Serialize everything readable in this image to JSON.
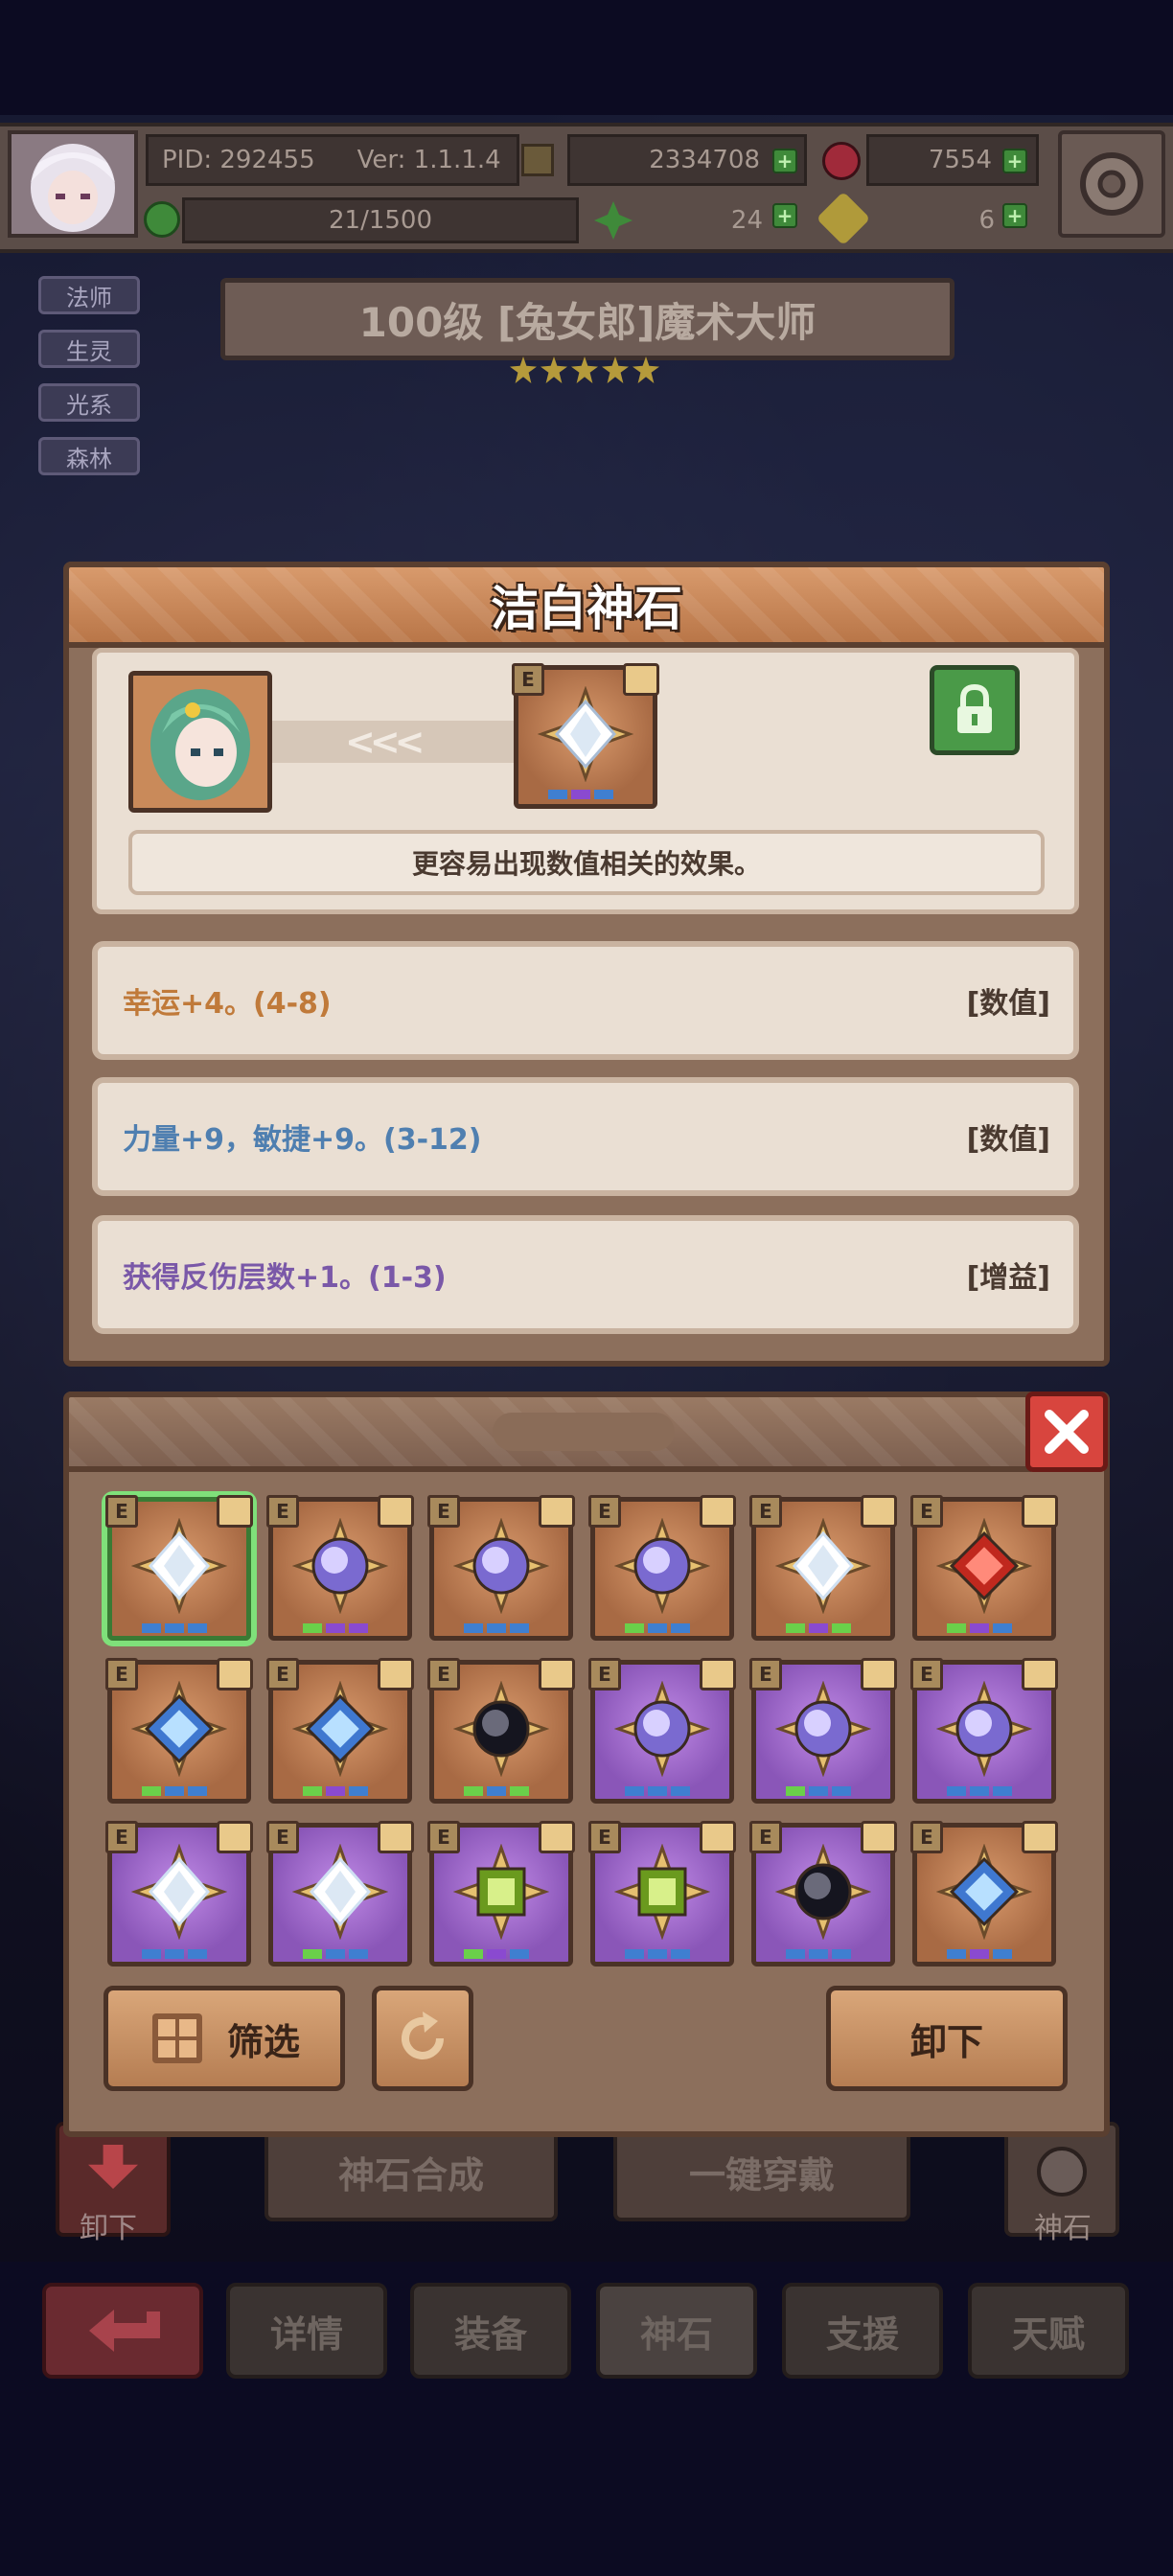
{
  "topbar": {
    "pid": "PID: 292455",
    "version": "Ver: 1.1.1.4",
    "gold": "2334708",
    "gems": "7554",
    "stamina": "21/1500",
    "clover": "24",
    "keys": "6"
  },
  "hero": {
    "tags": [
      "法师",
      "生灵",
      "光系",
      "森林"
    ],
    "title": "100级 [兔女郎]魔术大师",
    "stars": 5
  },
  "detail": {
    "title": "洁白神石",
    "chevrons": "<<<",
    "description": "更容易出现数值相关的效果。",
    "effects": [
      {
        "text": "幸运+4。(4-8)",
        "type": "[数值]",
        "color": "#c07a3a"
      },
      {
        "text": "力量+9，敏捷+9。(3-12)",
        "type": "[数值]",
        "color": "#4f7fb0"
      },
      {
        "text": "获得反伤层数+1。(1-3)",
        "type": "[增益]",
        "color": "#7a58a8"
      }
    ]
  },
  "inventory": {
    "badge": "E",
    "gems": [
      {
        "bg": "orange",
        "gem": "white",
        "selected": true,
        "dots": [
          "#3f7fd0",
          "#3f7fd0",
          "#3f7fd0"
        ]
      },
      {
        "bg": "orange",
        "gem": "violet",
        "dots": [
          "#6ad04a",
          "#8a4ad0",
          "#8a4ad0"
        ]
      },
      {
        "bg": "orange",
        "gem": "violet",
        "dots": [
          "#3f7fd0",
          "#3f7fd0",
          "#3f7fd0"
        ]
      },
      {
        "bg": "orange",
        "gem": "violet",
        "dots": [
          "#6ad04a",
          "#3f7fd0",
          "#3f7fd0"
        ]
      },
      {
        "bg": "orange",
        "gem": "white",
        "dots": [
          "#6ad04a",
          "#8a4ad0",
          "#6ad04a"
        ]
      },
      {
        "bg": "orange",
        "gem": "red",
        "dots": [
          "#6ad04a",
          "#8a4ad0",
          "#3f7fd0"
        ]
      },
      {
        "bg": "orange",
        "gem": "blue",
        "dots": [
          "#6ad04a",
          "#3f7fd0",
          "#3f7fd0"
        ]
      },
      {
        "bg": "orange",
        "gem": "blue",
        "dots": [
          "#6ad04a",
          "#8a4ad0",
          "#3f7fd0"
        ]
      },
      {
        "bg": "orange",
        "gem": "black",
        "dots": [
          "#6ad04a",
          "#3f7fd0",
          "#6ad04a"
        ]
      },
      {
        "bg": "purple",
        "gem": "violet",
        "dots": [
          "#3f7fd0",
          "#3f7fd0",
          "#3f7fd0"
        ]
      },
      {
        "bg": "purple",
        "gem": "violet",
        "dots": [
          "#6ad04a",
          "#3f7fd0",
          "#3f7fd0"
        ]
      },
      {
        "bg": "purple",
        "gem": "violet",
        "dots": [
          "#3f7fd0",
          "#3f7fd0",
          "#3f7fd0"
        ]
      },
      {
        "bg": "purple",
        "gem": "white",
        "dots": [
          "#3f7fd0",
          "#3f7fd0",
          "#3f7fd0"
        ]
      },
      {
        "bg": "purple",
        "gem": "white",
        "dots": [
          "#6ad04a",
          "#3f7fd0",
          "#3f7fd0"
        ]
      },
      {
        "bg": "purple",
        "gem": "green",
        "dots": [
          "#6ad04a",
          "#8a4ad0",
          "#3f7fd0"
        ]
      },
      {
        "bg": "purple",
        "gem": "green",
        "dots": [
          "#3f7fd0",
          "#3f7fd0",
          "#3f7fd0"
        ]
      },
      {
        "bg": "purple",
        "gem": "black",
        "dots": [
          "#3f7fd0",
          "#3f7fd0",
          "#3f7fd0"
        ]
      },
      {
        "bg": "orange",
        "gem": "blue",
        "dots": [
          "#3f7fd0",
          "#8a4ad0",
          "#3f7fd0"
        ]
      }
    ],
    "filter_label": "筛选",
    "unequip_label": "卸下"
  },
  "background": {
    "synth_label": "神石合成",
    "equip_all_label": "一键穿戴",
    "left_label": "卸下",
    "right_label": "神石"
  },
  "nav": {
    "details": "详情",
    "equipment": "装备",
    "godstone": "神石",
    "support": "支援",
    "talent": "天赋"
  },
  "gem_colors": {
    "white": [
      "#ffffff",
      "#cfe0f2"
    ],
    "violet": [
      "#d8d0ff",
      "#7a6ad0"
    ],
    "red": [
      "#ff8a7a",
      "#c0281e"
    ],
    "blue": [
      "#b8e0ff",
      "#3f78d0"
    ],
    "black": [
      "#6a6a7a",
      "#15151f"
    ],
    "green": [
      "#d8f08a",
      "#6a9a1e"
    ]
  }
}
